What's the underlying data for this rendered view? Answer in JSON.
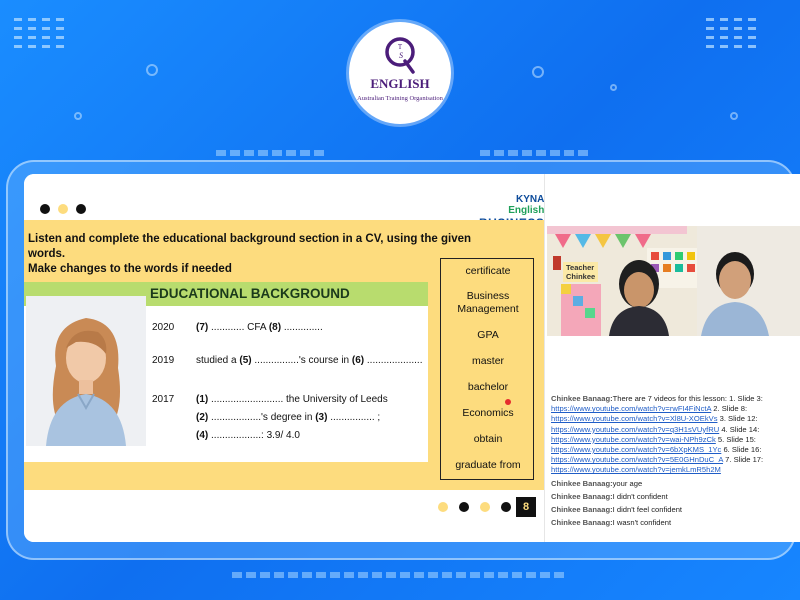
{
  "logo": {
    "title": "ENGLISH",
    "subtitle": "Australian Training Organisation",
    "mark_text": "QTS"
  },
  "brand": {
    "line1_a": "KYNA",
    "line1_b": " English",
    "line2": "BUSINESS"
  },
  "slide": {
    "instruction_line1": "Listen and complete the educational background section in a CV, using the given words.",
    "instruction_line2": "Make changes to the words if needed",
    "section_title": "EDUCATIONAL BACKGROUND",
    "rows": {
      "r1_year": "2020",
      "r1_n7": "(7)",
      "r1_t1": " ............ CFA ",
      "r1_n8": "(8)",
      "r1_t2": " ..............",
      "r2_year": "2019",
      "r2_t1": "studied a ",
      "r2_n5": "(5)",
      "r2_t2": " ................'s course in ",
      "r2_n6": "(6)",
      "r2_t3": " ....................",
      "r3_year": "2017",
      "r3_n1": "(1)",
      "r3_t1": " .......................... the University of Leeds",
      "r4_n2": "(2)",
      "r4_t1": " ..................'s degree in ",
      "r4_n3": "(3)",
      "r4_t2": " ................ ;",
      "r5_n4": "(4)",
      "r5_t1": " ..................: 3.9/ 4.0"
    },
    "words": [
      "certificate",
      "Business",
      "Management",
      "GPA",
      "master",
      "bachelor",
      "Economics",
      "obtain",
      "graduate from"
    ],
    "page_number": "8"
  },
  "video": {
    "label_line1": "Teacher",
    "label_line2": "Chinkee"
  },
  "chat": {
    "line1_name": "Chinkee Banaag:",
    "line1_text": "There are 7 videos for this lesson: 1. Slide 3:",
    "link1": "https://www.youtube.com/watch?v=rwFI4FiNctA",
    "after1": " 2. Slide 8:",
    "link2": "https://www.youtube.com/watch?v=Xl8U-XOEkVs",
    "after2": " 3. Slide 12:",
    "link3": "https://www.youtube.com/watch?v=q3H1sVUyfRU",
    "after3": " 4. Slide 14:",
    "link4": "https://www.youtube.com/watch?v=wai-NPh9zCk",
    "after4": " 5. Slide 15:",
    "link5": "https://www.youtube.com/watch?v=6bXpKMS_1Yc",
    "after5": " 6. Slide 16:",
    "link6": "https://www.youtube.com/watch?v=5E0GHnDuC_A",
    "after6": " 7. Slide 17:",
    "link7": "https://www.youtube.com/watch?v=jemkLmR5h2M",
    "m2_name": "Chinkee Banaag:",
    "m2_text": "your age",
    "m3_name": "Chinkee Banaag:",
    "m3_text": "I didn't confident",
    "m4_name": "Chinkee Banaag:",
    "m4_text": "I didn't feel confident",
    "m5_name": "Chinkee Banaag:",
    "m5_text": "I wasn't confident"
  },
  "colors": {
    "background": "#1786ff",
    "slide_yellow": "#fddc7e",
    "section_green": "#b8dc6e",
    "logo_purple": "#4b1d7a",
    "link_blue": "#1f5dc7"
  }
}
